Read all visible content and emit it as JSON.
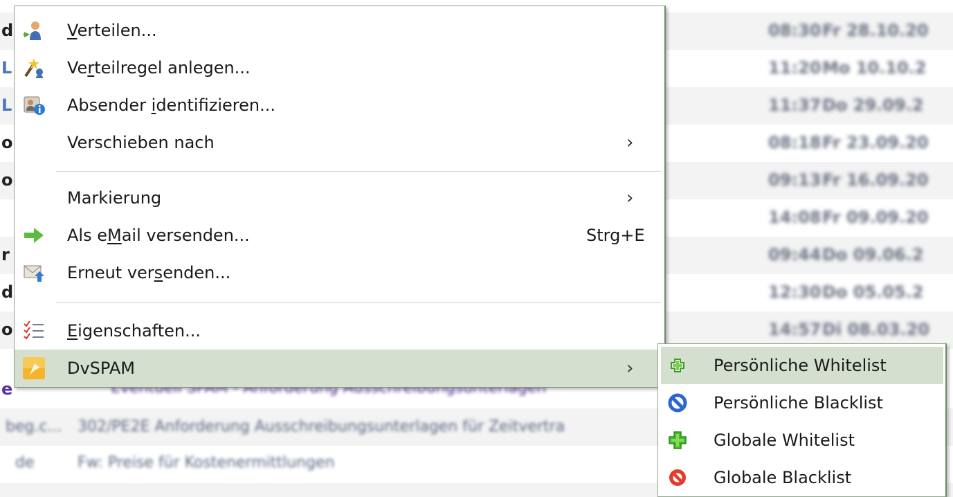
{
  "menu": {
    "items": [
      {
        "label_pre": "",
        "label_u": "V",
        "label_post": "erteilen...",
        "icon": "person-share-icon"
      },
      {
        "label_pre": "Ve",
        "label_u": "r",
        "label_post": "teilregel anlegen...",
        "icon": "magic-wand-rule-icon"
      },
      {
        "label_pre": "Absender ",
        "label_u": "i",
        "label_post": "dentifizieren...",
        "icon": "contact-card-info-icon"
      },
      {
        "label_pre": "Verschieben nach",
        "label_u": "",
        "label_post": "",
        "arrow": "›"
      },
      {
        "label_pre": "Markierung",
        "label_u": "",
        "label_post": "",
        "arrow": "›"
      },
      {
        "label_pre": "Als e",
        "label_u": "M",
        "label_post": "ail versenden...",
        "icon": "green-arrow-right-icon",
        "shortcut": "Strg+E"
      },
      {
        "label_pre": "Erneut ver",
        "label_u": "s",
        "label_post": "enden...",
        "icon": "envelope-resend-icon"
      },
      {
        "label_pre": "",
        "label_u": "E",
        "label_post": "igenschaften...",
        "icon": "checklist-icon"
      },
      {
        "label_pre": "DvSPAM",
        "label_u": "",
        "label_post": "",
        "icon": "dvspam-logo-icon",
        "arrow": "›"
      }
    ]
  },
  "submenu": {
    "items": [
      {
        "label": "Persönliche Whitelist",
        "icon": "small-green-plus-icon"
      },
      {
        "label": "Persönliche Blacklist",
        "icon": "blue-prohibited-icon"
      },
      {
        "label": "Globale Whitelist",
        "icon": "green-plus-icon"
      },
      {
        "label": "Globale Blacklist",
        "icon": "red-prohibited-icon"
      }
    ]
  },
  "background": {
    "rows": [
      {
        "time": "08:30",
        "date": "Fr 28.10.20"
      },
      {
        "time": "11:20",
        "date": "Mo 10.10.2"
      },
      {
        "time": "11:37",
        "date": "Do 29.09.2"
      },
      {
        "time": "08:18",
        "date": "Fr 23.09.20"
      },
      {
        "time": "09:13",
        "date": "Fr 16.09.20"
      },
      {
        "time": "14:08",
        "date": "Fr 09.09.20"
      },
      {
        "time": "09:44",
        "date": "Do 09.06.2"
      },
      {
        "time": "12:30",
        "date": "Do 05.05.2"
      },
      {
        "time": "14:57",
        "date": "Di 08.03.20"
      }
    ],
    "lower_rows": [
      {
        "sender": "",
        "subject": "Eventuell SPAM - Anforderung Ausschreibungsunterlagen"
      },
      {
        "sender": "beg.c...",
        "subject": "302/PE2E Anforderung Ausschreibungsunterlagen für Zeitvertra"
      },
      {
        "sender": "de",
        "subject": "Fw: Preise für Kostenermittlungen"
      }
    ]
  }
}
